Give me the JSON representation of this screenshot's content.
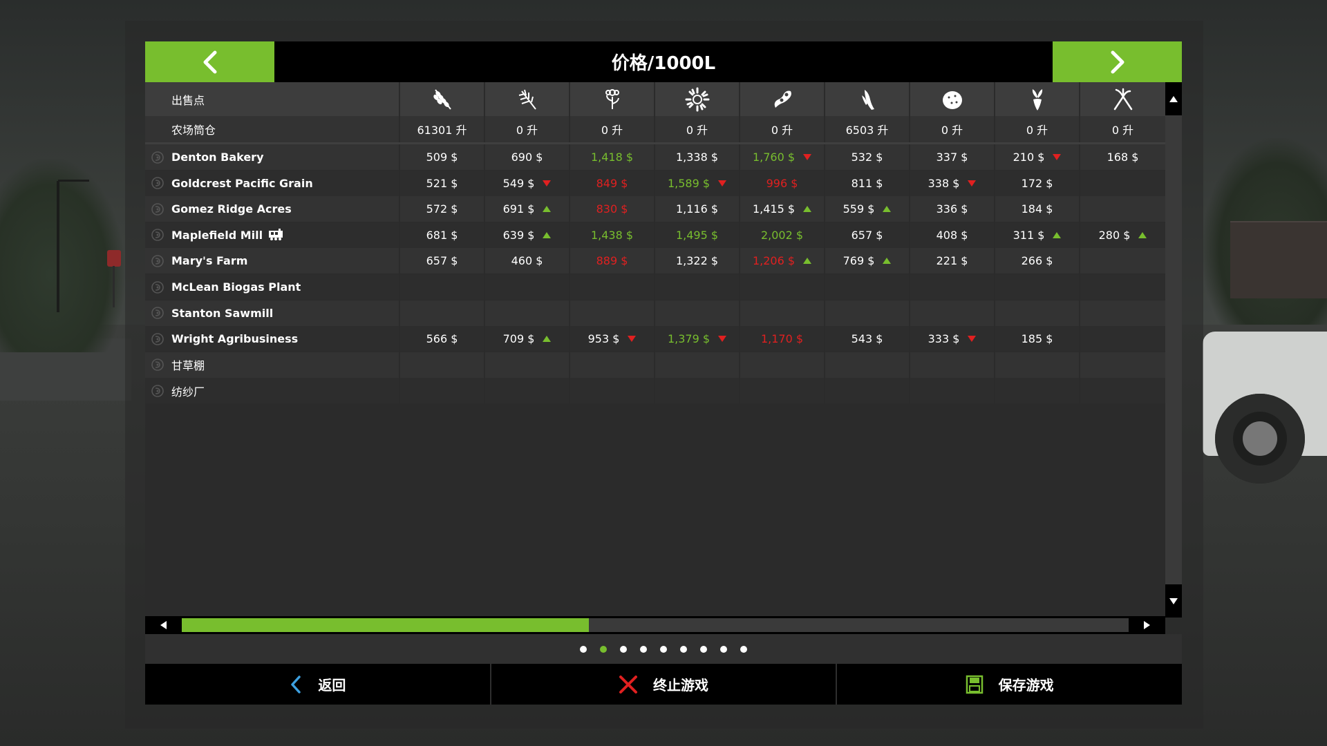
{
  "header": {
    "title": "价格/1000L",
    "prev_icon": "chevron-left-icon",
    "next_icon": "chevron-right-icon"
  },
  "table": {
    "corner_label": "出售点",
    "storage_label": "农场筒仓",
    "crop_icons": [
      "wheat-icon",
      "barley-icon",
      "rapeseed-icon",
      "sunflower-icon",
      "soybean-icon",
      "maize-icon",
      "potato-icon",
      "sugarbeet-icon",
      "grass-icon"
    ],
    "storage_values": [
      "61301 升",
      "0 升",
      "0 升",
      "0 升",
      "0 升",
      "6503 升",
      "0 升",
      "0 升",
      "0 升"
    ],
    "rows": [
      {
        "name": "Denton Bakery",
        "bold": true,
        "cells": [
          {
            "v": "509 $"
          },
          {
            "v": "690 $"
          },
          {
            "v": "1,418 $",
            "c": "green"
          },
          {
            "v": "1,338 $"
          },
          {
            "v": "1,760 $",
            "c": "green",
            "t": "down"
          },
          {
            "v": "532 $"
          },
          {
            "v": "337 $"
          },
          {
            "v": "210 $",
            "t": "down"
          },
          {
            "v": "168 $"
          }
        ]
      },
      {
        "name": "Goldcrest Pacific Grain",
        "bold": true,
        "cells": [
          {
            "v": "521 $"
          },
          {
            "v": "549 $",
            "t": "down"
          },
          {
            "v": "849 $",
            "c": "red"
          },
          {
            "v": "1,589 $",
            "c": "green",
            "t": "down"
          },
          {
            "v": "996 $",
            "c": "red"
          },
          {
            "v": "811 $"
          },
          {
            "v": "338 $",
            "t": "down"
          },
          {
            "v": "172 $"
          },
          {
            "v": ""
          }
        ]
      },
      {
        "name": "Gomez Ridge Acres",
        "bold": true,
        "cells": [
          {
            "v": "572 $"
          },
          {
            "v": "691 $",
            "t": "up"
          },
          {
            "v": "830 $",
            "c": "red"
          },
          {
            "v": "1,116 $"
          },
          {
            "v": "1,415 $",
            "t": "up"
          },
          {
            "v": "559 $",
            "t": "up"
          },
          {
            "v": "336 $"
          },
          {
            "v": "184 $"
          },
          {
            "v": ""
          }
        ]
      },
      {
        "name": "Maplefield Mill",
        "bold": true,
        "train": true,
        "cells": [
          {
            "v": "681 $"
          },
          {
            "v": "639 $",
            "t": "up"
          },
          {
            "v": "1,438 $",
            "c": "green"
          },
          {
            "v": "1,495 $",
            "c": "green"
          },
          {
            "v": "2,002 $",
            "c": "green"
          },
          {
            "v": "657 $"
          },
          {
            "v": "408 $"
          },
          {
            "v": "311 $",
            "t": "up"
          },
          {
            "v": "280 $",
            "t": "up"
          }
        ]
      },
      {
        "name": "Mary's Farm",
        "bold": true,
        "cells": [
          {
            "v": "657 $"
          },
          {
            "v": "460 $"
          },
          {
            "v": "889 $",
            "c": "red"
          },
          {
            "v": "1,322 $"
          },
          {
            "v": "1,206 $",
            "c": "red",
            "t": "up"
          },
          {
            "v": "769 $",
            "t": "up"
          },
          {
            "v": "221 $"
          },
          {
            "v": "266 $"
          },
          {
            "v": ""
          }
        ]
      },
      {
        "name": "McLean Biogas Plant",
        "bold": true,
        "cells": [
          {
            "v": ""
          },
          {
            "v": ""
          },
          {
            "v": ""
          },
          {
            "v": ""
          },
          {
            "v": ""
          },
          {
            "v": ""
          },
          {
            "v": ""
          },
          {
            "v": ""
          },
          {
            "v": ""
          }
        ]
      },
      {
        "name": "Stanton Sawmill",
        "bold": true,
        "cells": [
          {
            "v": ""
          },
          {
            "v": ""
          },
          {
            "v": ""
          },
          {
            "v": ""
          },
          {
            "v": ""
          },
          {
            "v": ""
          },
          {
            "v": ""
          },
          {
            "v": ""
          },
          {
            "v": ""
          }
        ]
      },
      {
        "name": "Wright Agribusiness",
        "bold": true,
        "cells": [
          {
            "v": "566 $"
          },
          {
            "v": "709 $",
            "t": "up"
          },
          {
            "v": "953 $",
            "t": "down"
          },
          {
            "v": "1,379 $",
            "c": "green",
            "t": "down"
          },
          {
            "v": "1,170 $",
            "c": "red"
          },
          {
            "v": "543 $"
          },
          {
            "v": "333 $",
            "t": "down"
          },
          {
            "v": "185 $"
          },
          {
            "v": ""
          }
        ]
      },
      {
        "name": "甘草棚",
        "bold": false,
        "cells": [
          {
            "v": ""
          },
          {
            "v": ""
          },
          {
            "v": ""
          },
          {
            "v": ""
          },
          {
            "v": ""
          },
          {
            "v": ""
          },
          {
            "v": ""
          },
          {
            "v": ""
          },
          {
            "v": ""
          }
        ]
      },
      {
        "name": "纺纱厂",
        "bold": false,
        "cells": [
          {
            "v": ""
          },
          {
            "v": ""
          },
          {
            "v": ""
          },
          {
            "v": ""
          },
          {
            "v": ""
          },
          {
            "v": ""
          },
          {
            "v": ""
          },
          {
            "v": ""
          },
          {
            "v": ""
          }
        ]
      }
    ]
  },
  "scroll": {
    "horizontal_fraction": 0.43
  },
  "pager": {
    "count": 9,
    "active_index": 1
  },
  "footer": {
    "back_label": "返回",
    "quit_label": "终止游戏",
    "save_label": "保存游戏"
  },
  "colors": {
    "accent": "#78be2e",
    "price_up": "#78be2e",
    "price_down": "#e02020",
    "panel_bg": "#2b2b2b"
  }
}
